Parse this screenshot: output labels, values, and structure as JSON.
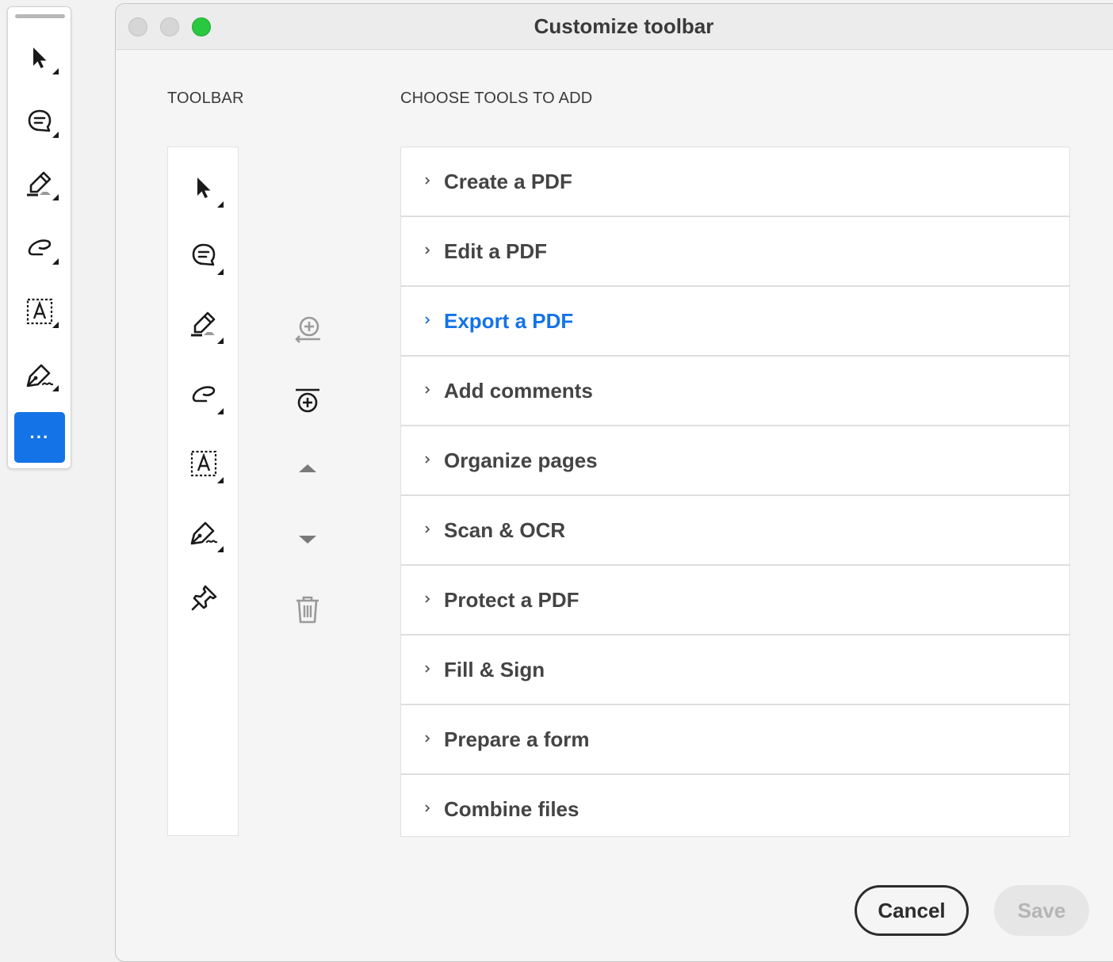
{
  "floating_toolbar": {
    "tools": [
      {
        "name": "select-pointer-icon"
      },
      {
        "name": "comment-icon"
      },
      {
        "name": "highlighter-icon"
      },
      {
        "name": "freehand-draw-icon"
      },
      {
        "name": "text-box-icon"
      },
      {
        "name": "sign-pen-icon"
      }
    ],
    "more_label": "···",
    "more_color": "#1473e6"
  },
  "window": {
    "title": "Customize toolbar"
  },
  "toolbar_section": {
    "heading": "TOOLBAR",
    "tools": [
      {
        "name": "select-pointer-icon"
      },
      {
        "name": "comment-icon"
      },
      {
        "name": "highlighter-icon"
      },
      {
        "name": "freehand-draw-icon"
      },
      {
        "name": "text-box-icon"
      },
      {
        "name": "sign-pen-icon"
      },
      {
        "name": "pin-icon"
      }
    ]
  },
  "actions": [
    {
      "name": "add-to-toolbar-icon"
    },
    {
      "name": "add-divider-icon"
    },
    {
      "name": "move-up-icon"
    },
    {
      "name": "move-down-icon"
    },
    {
      "name": "delete-icon"
    }
  ],
  "tools_section": {
    "heading": "CHOOSE TOOLS TO ADD",
    "items": [
      {
        "label": "Create a PDF",
        "active": false
      },
      {
        "label": "Edit a PDF",
        "active": false
      },
      {
        "label": "Export a PDF",
        "active": true
      },
      {
        "label": "Add comments",
        "active": false
      },
      {
        "label": "Organize pages",
        "active": false
      },
      {
        "label": "Scan & OCR",
        "active": false
      },
      {
        "label": "Protect a PDF",
        "active": false
      },
      {
        "label": "Fill & Sign",
        "active": false
      },
      {
        "label": "Prepare a form",
        "active": false
      },
      {
        "label": "Combine files",
        "active": false
      }
    ],
    "accent_color": "#1473e6"
  },
  "footer": {
    "cancel_label": "Cancel",
    "save_label": "Save"
  }
}
